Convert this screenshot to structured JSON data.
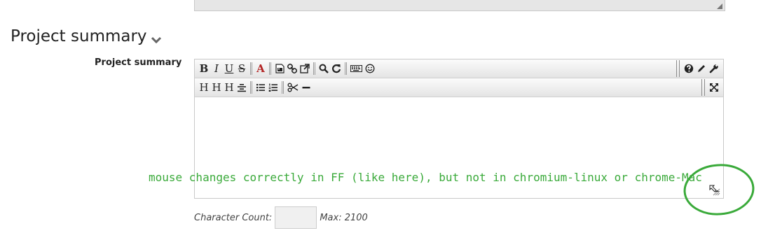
{
  "section": {
    "title": "Project summary"
  },
  "field": {
    "label": "Project summary"
  },
  "toolbar": {
    "row1_left": [
      {
        "glyph": "B",
        "icon": "bold-icon"
      },
      {
        "glyph": "I",
        "icon": "italic-icon"
      },
      {
        "glyph": "U",
        "icon": "underline-icon"
      },
      {
        "glyph": "S",
        "icon": "strikethrough-icon"
      },
      {
        "glyph": "A",
        "icon": "font-color-icon"
      }
    ],
    "row2_left": [
      {
        "glyph": "H",
        "icon": "heading1-icon"
      },
      {
        "glyph": "H",
        "icon": "heading2-icon"
      },
      {
        "glyph": "H",
        "icon": "heading3-icon"
      }
    ]
  },
  "annotation": {
    "text": "mouse changes correctly in FF (like here), but not in chromium-linux or chrome-Mac",
    "color": "#3aaa3a"
  },
  "character_count": {
    "label": "Character Count:",
    "value": "",
    "max_text": "Max: 2100"
  }
}
